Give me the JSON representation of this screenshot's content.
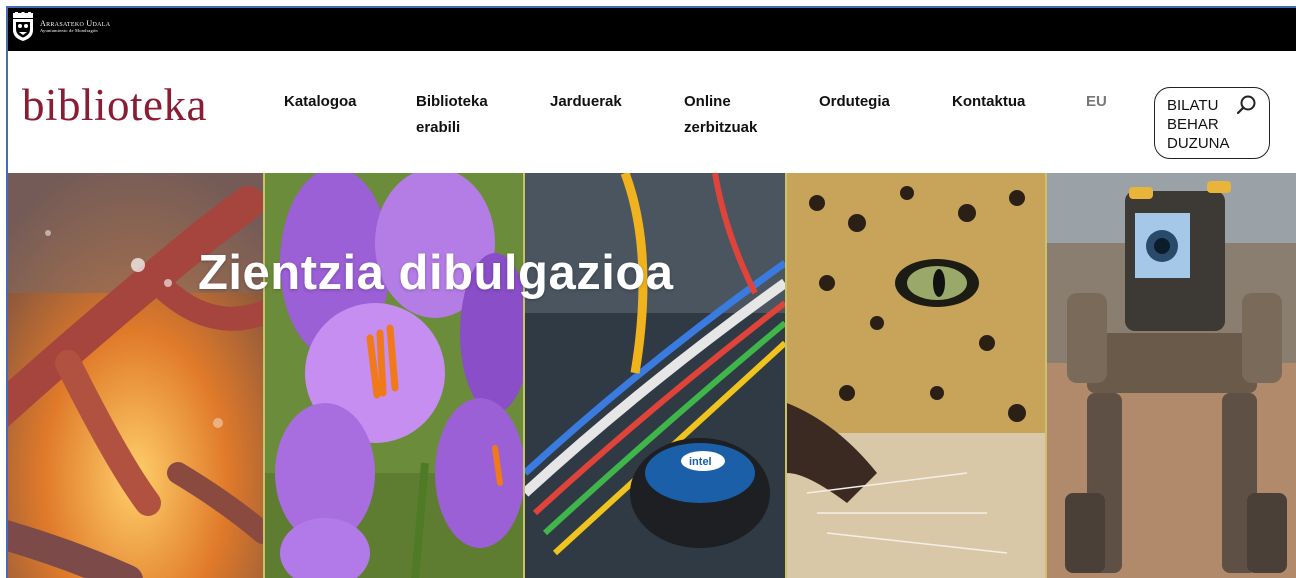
{
  "municipality": {
    "title": "Arrasateko Udala",
    "subtitle": "Ayuntamiento de Mondragón"
  },
  "logo": "biblioteka",
  "nav": {
    "items": [
      {
        "line1": "Katalogoa",
        "line2": ""
      },
      {
        "line1": "Biblioteka",
        "line2": "erabili"
      },
      {
        "line1": "Jarduerak",
        "line2": ""
      },
      {
        "line1": "Online",
        "line2": "zerbitzuak"
      },
      {
        "line1": "Ordutegia",
        "line2": ""
      },
      {
        "line1": "Kontaktua",
        "line2": ""
      }
    ],
    "language": "EU"
  },
  "search": {
    "line1": "BILATU",
    "line2": "BEHAR",
    "line3": "DUZUNA",
    "icon": "search-icon"
  },
  "hero": {
    "title": "Zientzia dibulgazioa",
    "panels": [
      "molecule-image",
      "crocus-flowers-image",
      "computer-cables-image",
      "leopard-image",
      "robot-image"
    ]
  },
  "colors": {
    "topbar": "#000000",
    "logo": "#8a1c34",
    "divider": "#c9c26a",
    "lang": "#777777"
  }
}
